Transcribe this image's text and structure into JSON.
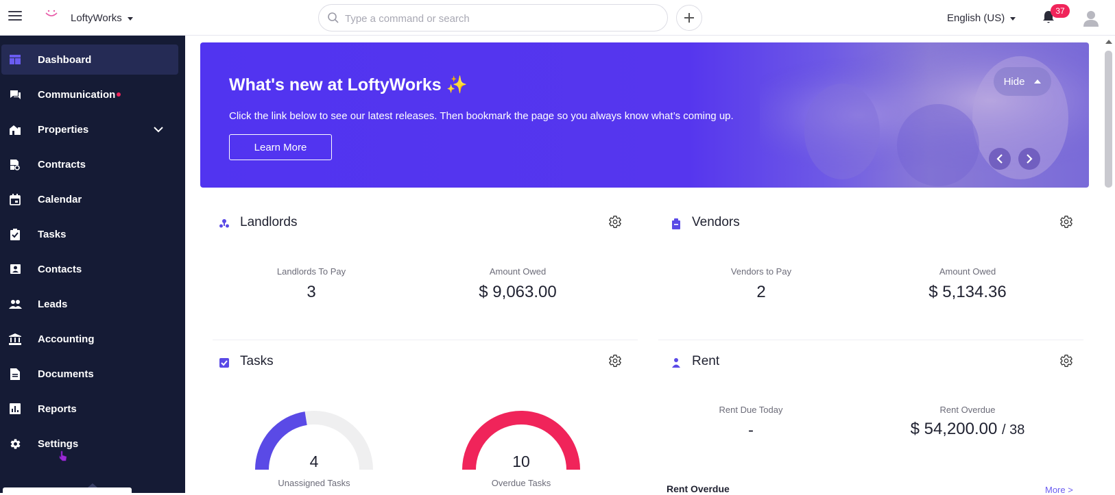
{
  "header": {
    "org_name": "LoftyWorks",
    "search_placeholder": "Type a command or search",
    "language": "English (US)",
    "notification_count": "37"
  },
  "sidebar": {
    "items": [
      {
        "label": "Dashboard",
        "icon": "dashboard-icon"
      },
      {
        "label": "Communication",
        "icon": "chat-icon"
      },
      {
        "label": "Properties",
        "icon": "properties-icon"
      },
      {
        "label": "Contracts",
        "icon": "contracts-icon"
      },
      {
        "label": "Calendar",
        "icon": "calendar-icon"
      },
      {
        "label": "Tasks",
        "icon": "tasks-icon"
      },
      {
        "label": "Contacts",
        "icon": "contacts-icon"
      },
      {
        "label": "Leads",
        "icon": "leads-icon"
      },
      {
        "label": "Accounting",
        "icon": "accounting-icon"
      },
      {
        "label": "Documents",
        "icon": "documents-icon"
      },
      {
        "label": "Reports",
        "icon": "reports-icon"
      },
      {
        "label": "Settings",
        "icon": "gear-icon"
      }
    ]
  },
  "banner": {
    "title": "What's new at LoftyWorks ✨",
    "subtitle": "Click the link below to see our latest releases. Then bookmark the page so you always know what’s coming up.",
    "button": "Learn More",
    "hide": "Hide"
  },
  "landlords": {
    "title": "Landlords",
    "to_pay_label": "Landlords To Pay",
    "to_pay_value": "3",
    "owed_label": "Amount Owed",
    "owed_value": "$ 9,063.00"
  },
  "vendors": {
    "title": "Vendors",
    "to_pay_label": "Vendors to Pay",
    "to_pay_value": "2",
    "owed_label": "Amount Owed",
    "owed_value": "$ 5,134.36"
  },
  "tasks": {
    "title": "Tasks",
    "unassigned_value": "4",
    "unassigned_label": "Unassigned Tasks",
    "unassigned_fraction": 0.45,
    "overdue_value": "10",
    "overdue_label": "Overdue Tasks",
    "overdue_fraction": 1.0
  },
  "rent": {
    "title": "Rent",
    "due_today_label": "Rent Due Today",
    "due_today_value": "-",
    "overdue_label": "Rent Overdue",
    "overdue_value": "$ 54,200.00",
    "overdue_count": "/ 38",
    "section_title": "Rent Overdue",
    "more": "More >"
  },
  "colors": {
    "sidebar": "#151b35",
    "accent": "#5134f0",
    "alert": "#f0245a"
  }
}
